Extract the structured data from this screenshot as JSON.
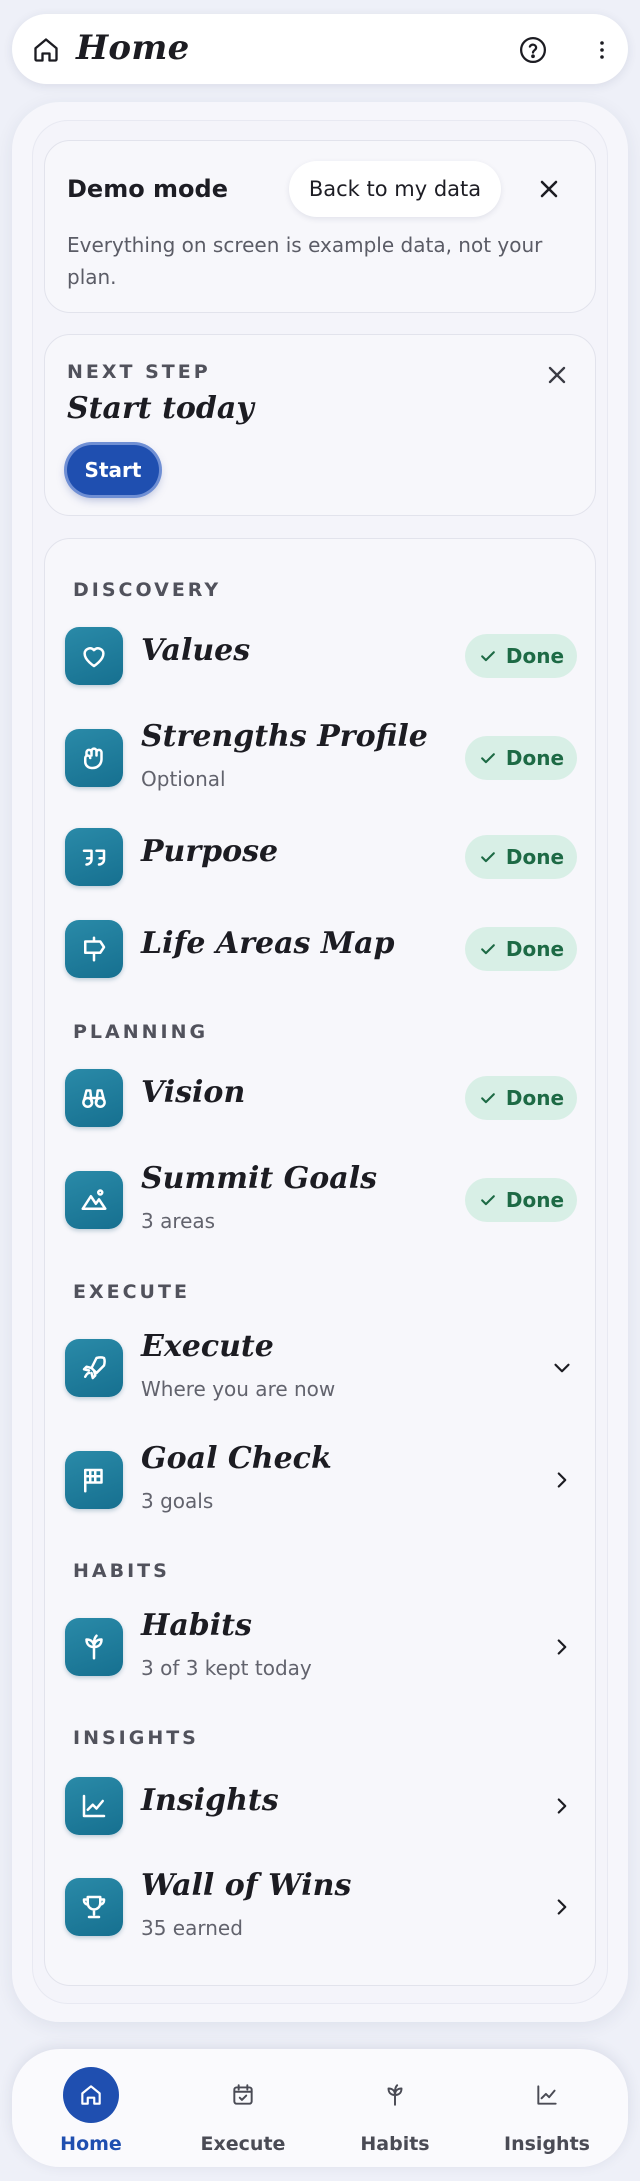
{
  "header": {
    "title": "Home",
    "icons": [
      "home-icon",
      "help-circle-icon",
      "more-vertical-icon"
    ]
  },
  "demo": {
    "title": "Demo mode",
    "back_label": "Back to my data",
    "description": "Everything on screen is example data, not your plan."
  },
  "next_step": {
    "label": "NEXT STEP",
    "title": "Start today",
    "button": "Start"
  },
  "sections": {
    "discovery": "DISCOVERY",
    "planning": "PLANNING",
    "execute": "EXECUTE",
    "habits": "HABITS",
    "insights": "INSIGHTS"
  },
  "items": {
    "values": {
      "name": "Values",
      "status": "Done",
      "icon": "heart-icon"
    },
    "strengths": {
      "name": "Strengths Profile",
      "sub": "Optional",
      "status": "Done",
      "icon": "fist-icon"
    },
    "purpose": {
      "name": "Purpose",
      "status": "Done",
      "icon": "quote-icon"
    },
    "life_areas": {
      "name": "Life Areas Map",
      "status": "Done",
      "icon": "signpost-icon"
    },
    "vision": {
      "name": "Vision",
      "status": "Done",
      "icon": "binoculars-icon"
    },
    "summit": {
      "name": "Summit Goals",
      "sub": "3 areas",
      "status": "Done",
      "icon": "mountain-icon"
    },
    "execute": {
      "name": "Execute",
      "sub": "Where you are now",
      "icon": "rocket-icon"
    },
    "goal_check": {
      "name": "Goal Check",
      "sub": "3 goals",
      "icon": "flag-icon"
    },
    "habits": {
      "name": "Habits",
      "sub": "3 of 3 kept today",
      "icon": "sprout-icon"
    },
    "insights": {
      "name": "Insights",
      "icon": "line-chart-icon"
    },
    "wins": {
      "name": "Wall of Wins",
      "sub": "35 earned",
      "icon": "trophy-icon"
    }
  },
  "nav": {
    "home": "Home",
    "execute": "Execute",
    "habits": "Habits",
    "insights": "Insights",
    "active": "Home"
  },
  "colors": {
    "accent": "#1f4fb0",
    "tile": "#1f7d9c",
    "done_bg": "#d8efe6",
    "done_text": "#1d6a45"
  }
}
